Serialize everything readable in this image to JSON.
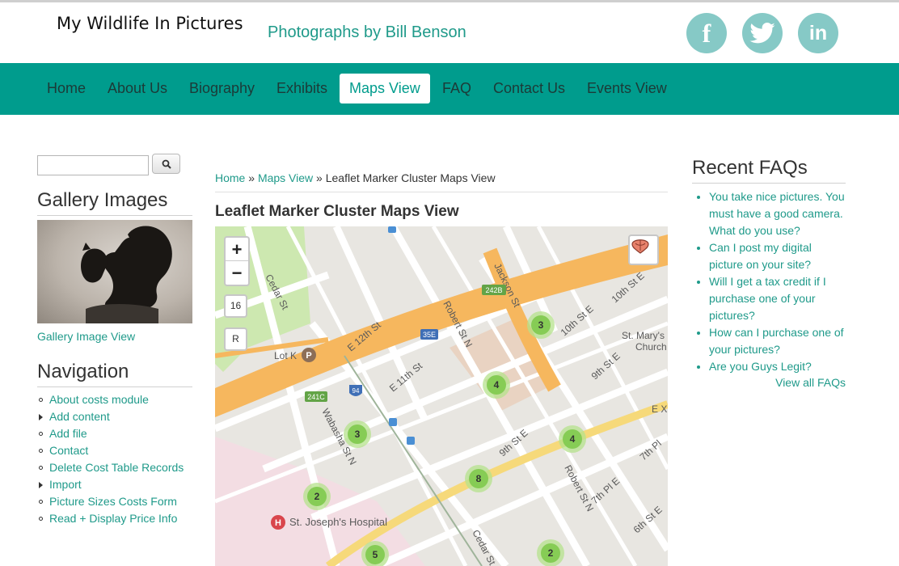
{
  "header": {
    "site_name": "My Wildlife In Pictures",
    "slogan": "Photographs by Bill Benson",
    "social": {
      "facebook": "f",
      "linkedin": "in"
    }
  },
  "nav": {
    "items": [
      "Home",
      "About Us",
      "Biography",
      "Exhibits",
      "Maps View",
      "FAQ",
      "Contact Us",
      "Events View"
    ],
    "active": "Maps View"
  },
  "search": {
    "value": "",
    "placeholder": ""
  },
  "gallery": {
    "title": "Gallery Images",
    "link": "Gallery Image View"
  },
  "navigation": {
    "title": "Navigation",
    "items": [
      "About costs module",
      "Add content",
      "Add file",
      "Contact",
      "Delete Cost Table Records",
      "Import",
      "Picture Sizes Costs Form",
      "Read + Display Price Info"
    ]
  },
  "breadcrumb": {
    "home": "Home",
    "sep1": "»",
    "maps": "Maps View",
    "sep2": "»",
    "current": "Leaflet Marker Cluster Maps View"
  },
  "page_title": "Leaflet Marker Cluster Maps View",
  "map": {
    "zoom_in": "+",
    "zoom_out": "−",
    "zoom_level": "16",
    "reset_label": "R",
    "labels": {
      "cedar_st": "Cedar St",
      "jackson_st": "Jackson St",
      "robert_st_n": "Robert St N",
      "robert_st_n_2": "Robert St N",
      "tenth_st_e": "10th St E",
      "tenth_st_e_2": "10th St E",
      "e_12th_st": "E 12th St",
      "e_11th_st": "E 11th St",
      "ninth_st_e": "9th St E",
      "ninth_st_e_2": "9th St E",
      "wabasha_st_n": "Wabasha St N",
      "seventh_pl_e": "7th Pl E",
      "seventh_pl": "7th Pl",
      "sixth_st_e": "6th St E",
      "cedar_st_2": "Cedar St",
      "st_marys": "St. Mary's",
      "church": "Church",
      "lot_k": "Lot K",
      "parking": "P",
      "hospital": "St. Joseph's Hospital",
      "hospital_icon": "H",
      "ex": "E X",
      "shield_2428": "242B",
      "shield_35e": "35E",
      "shield_241c": "241C",
      "shield_94": "94"
    },
    "clusters": [
      {
        "count": "3"
      },
      {
        "count": "4"
      },
      {
        "count": "3"
      },
      {
        "count": "4"
      },
      {
        "count": "8"
      },
      {
        "count": "2"
      },
      {
        "count": "5"
      },
      {
        "count": "2"
      }
    ]
  },
  "faqs": {
    "title": "Recent FAQs",
    "items": [
      {
        "line1": "You take nice pictures. You",
        "line2": "must have a good camera.",
        "line3": "What do you use?"
      },
      {
        "line1": "Can I post my digital",
        "line2": "picture on your site?"
      },
      {
        "line1": "Will I get a tax credit if I",
        "line2": "purchase one of your",
        "line3": "pictures?"
      },
      {
        "line1": "How can I purchase one of",
        "line2": "your pictures?"
      },
      {
        "line1": "Are you Guys Legit?"
      }
    ],
    "view_all": "View all FAQs"
  },
  "colors": {
    "teal": "#009c8d",
    "link": "#1f9a8a",
    "social_circle": "#86c9c6",
    "highway": "#f6b75e",
    "park": "#cde8b0",
    "cluster": "#86cc55"
  }
}
